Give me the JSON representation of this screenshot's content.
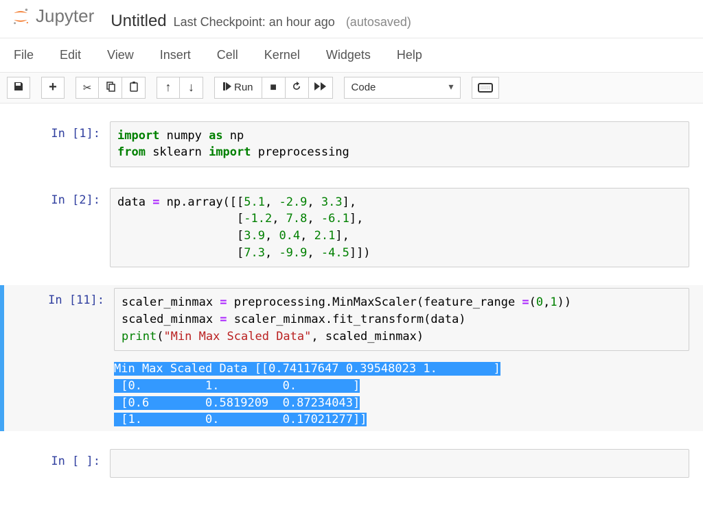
{
  "header": {
    "logo_text": "Jupyter",
    "title": "Untitled",
    "checkpoint": "Last Checkpoint: an hour ago",
    "autosave": "(autosaved)"
  },
  "menubar": {
    "items": [
      "File",
      "Edit",
      "View",
      "Insert",
      "Cell",
      "Kernel",
      "Widgets",
      "Help"
    ]
  },
  "toolbar": {
    "save_icon": "💾",
    "add_icon": "+",
    "cut_icon": "✂",
    "copy_icon": "⎘",
    "paste_icon": "📋",
    "up_icon": "↑",
    "down_icon": "↓",
    "run_icon": "▶",
    "run_label": "Run",
    "stop_icon": "■",
    "restart_icon": "↻",
    "ff_icon": "▶▶",
    "celltype_selected": "Code"
  },
  "cells": [
    {
      "prompt": "In [1]:",
      "code_html": "<span class='kw'>import</span> numpy <span class='kw'>as</span> np\n<span class='kw'>from</span> sklearn <span class='kw'>import</span> preprocessing"
    },
    {
      "prompt": "In [2]:",
      "code_html": "data <span class='op'>=</span> np.array([[<span class='num'>5.1</span>, <span class='num'>-2.9</span>, <span class='num'>3.3</span>],\n                 [<span class='num'>-1.2</span>, <span class='num'>7.8</span>, <span class='num'>-6.1</span>],\n                 [<span class='num'>3.9</span>, <span class='num'>0.4</span>, <span class='num'>2.1</span>],\n                 [<span class='num'>7.3</span>, <span class='num'>-9.9</span>, <span class='num'>-4.5</span>]])"
    },
    {
      "prompt": "In [11]:",
      "selected": true,
      "code_html": "scaler_minmax <span class='op'>=</span> preprocessing.MinMaxScaler(feature_range <span class='op'>=</span>(<span class='num'>0</span>,<span class='num'>1</span>))\nscaled_minmax <span class='op'>=</span> scaler_minmax.fit_transform(data)\n<span class='builtin'>print</span>(<span class='str'>\"Min Max Scaled Data\"</span>, scaled_minmax)",
      "output_lines": [
        "Min Max Scaled Data [[0.74117647 0.39548023 1.        ]",
        " [0.         1.         0.        ]",
        " [0.6        0.5819209  0.87234043]",
        " [1.         0.         0.17021277]]"
      ]
    },
    {
      "prompt": "In [ ]:",
      "code_html": " "
    }
  ]
}
